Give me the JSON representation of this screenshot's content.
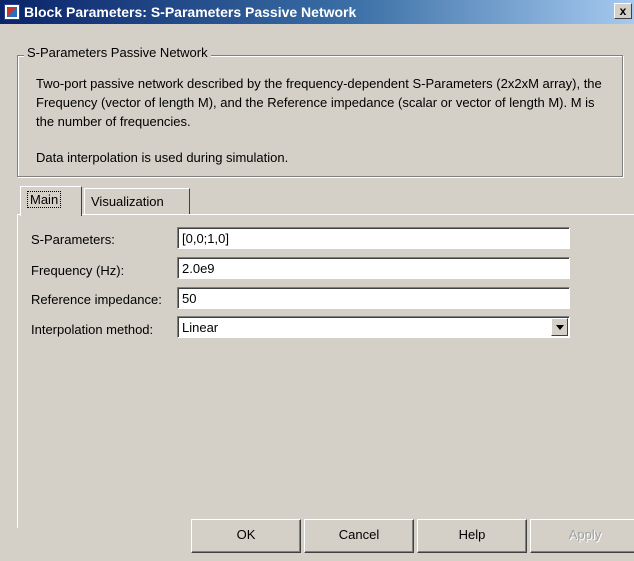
{
  "window": {
    "title": "Block Parameters: S-Parameters Passive Network",
    "close_label": "x",
    "icon": "simulink-block-icon"
  },
  "group": {
    "legend": "S-Parameters Passive Network",
    "description": "Two-port passive network described by the frequency-dependent S-Parameters (2x2xM array),  the Frequency (vector of length M), and the Reference impedance (scalar or vector of length M).  M is the number of frequencies.",
    "note": "Data interpolation is used during simulation."
  },
  "tabs": [
    {
      "label": "Main",
      "active": true
    },
    {
      "label": "Visualization",
      "active": false
    }
  ],
  "params": {
    "sparams": {
      "label": "S-Parameters:",
      "value": "[0,0;1,0]"
    },
    "frequency": {
      "label": "Frequency (Hz):",
      "value": "2.0e9"
    },
    "impedance": {
      "label": "Reference impedance:",
      "value": "50"
    },
    "interpolation": {
      "label": "Interpolation method:",
      "value": "Linear"
    }
  },
  "buttons": {
    "ok": "OK",
    "cancel": "Cancel",
    "help": "Help",
    "apply": "Apply"
  }
}
